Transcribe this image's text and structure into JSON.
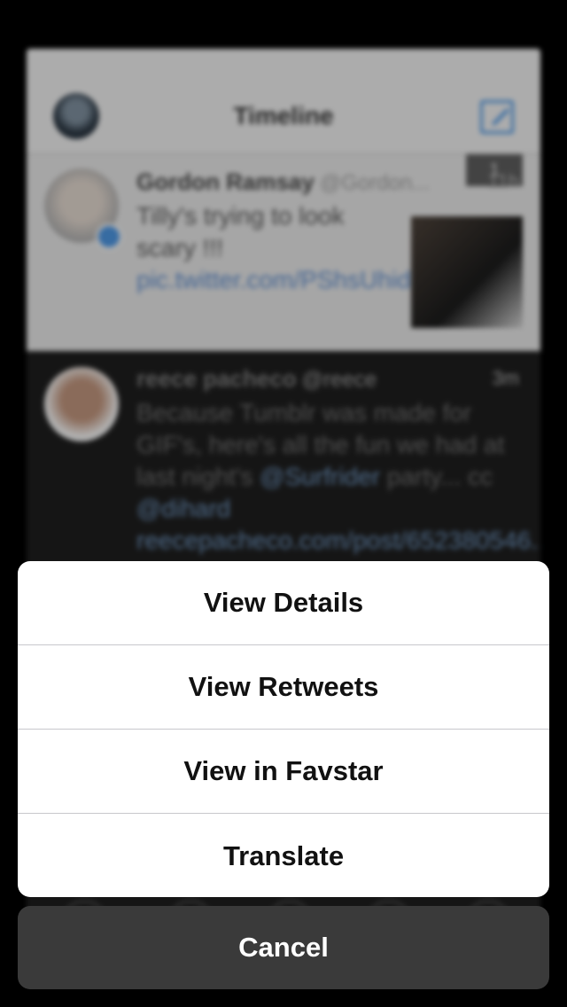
{
  "background": {
    "nav_title": "Timeline",
    "new_badge": "1",
    "tweets": [
      {
        "name": "Gordon Ramsay",
        "handle": "@Gordon...",
        "time": "11h",
        "text": "Tilly's trying to look scary !!!",
        "link": "pic.twitter.com/PShsUhid7b"
      },
      {
        "name": "reece pacheco",
        "handle": "@reece",
        "time": "3m",
        "text": "Because Tumblr was made for GIF's, here's all the fun we had at last night's",
        "mention": "@Surfrider",
        "text2": "party... cc",
        "mention2": "@dihard",
        "link": "reecepacheco.com/post/652380546..."
      }
    ]
  },
  "action_sheet": {
    "items": [
      "View Details",
      "View Retweets",
      "View in Favstar",
      "Translate"
    ],
    "cancel": "Cancel"
  },
  "colors": {
    "accent": "#4a90d9",
    "sheet_bg": "#ffffff",
    "cancel_bg": "#3a3a3a"
  }
}
